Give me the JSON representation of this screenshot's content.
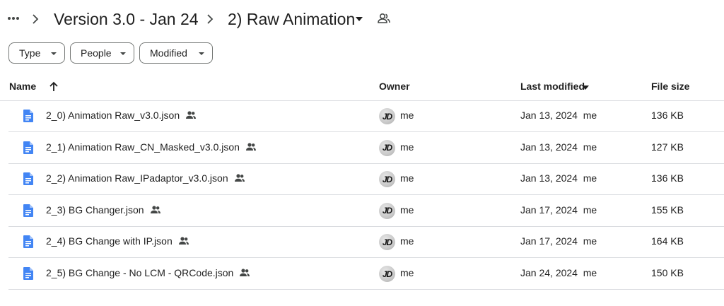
{
  "breadcrumb": {
    "more_icon": "more-horiz-icon",
    "items": [
      {
        "label": "Version 3.0 - Jan 24"
      },
      {
        "label": "2) Raw Animation"
      }
    ],
    "shared_icon": "people-icon"
  },
  "filters": [
    {
      "label": "Type"
    },
    {
      "label": "People"
    },
    {
      "label": "Modified"
    }
  ],
  "table": {
    "headers": {
      "name": "Name",
      "owner": "Owner",
      "last_modified": "Last modified",
      "file_size": "File size"
    },
    "sort": {
      "column": "name",
      "direction": "ascending"
    },
    "rows": [
      {
        "name": "2_0) Animation Raw_v3.0.json",
        "owner": "me",
        "avatar": "JD",
        "modified": "Jan 13, 2024  me",
        "size": "136 KB"
      },
      {
        "name": "2_1) Animation Raw_CN_Masked_v3.0.json",
        "owner": "me",
        "avatar": "JD",
        "modified": "Jan 13, 2024  me",
        "size": "127 KB"
      },
      {
        "name": "2_2) Animation Raw_IPadaptor_v3.0.json",
        "owner": "me",
        "avatar": "JD",
        "modified": "Jan 13, 2024  me",
        "size": "136 KB"
      },
      {
        "name": "2_3) BG Changer.json",
        "owner": "me",
        "avatar": "JD",
        "modified": "Jan 17, 2024  me",
        "size": "155 KB"
      },
      {
        "name": "2_4) BG Change with IP.json",
        "owner": "me",
        "avatar": "JD",
        "modified": "Jan 17, 2024  me",
        "size": "164 KB"
      },
      {
        "name": "2_5) BG Change - No LCM - QRCode.json",
        "owner": "me",
        "avatar": "JD",
        "modified": "Jan 24, 2024  me",
        "size": "150 KB"
      }
    ]
  },
  "colors": {
    "doc_icon": "#4285f4",
    "divider": "#dadce0",
    "text": "#1f1f1f"
  }
}
